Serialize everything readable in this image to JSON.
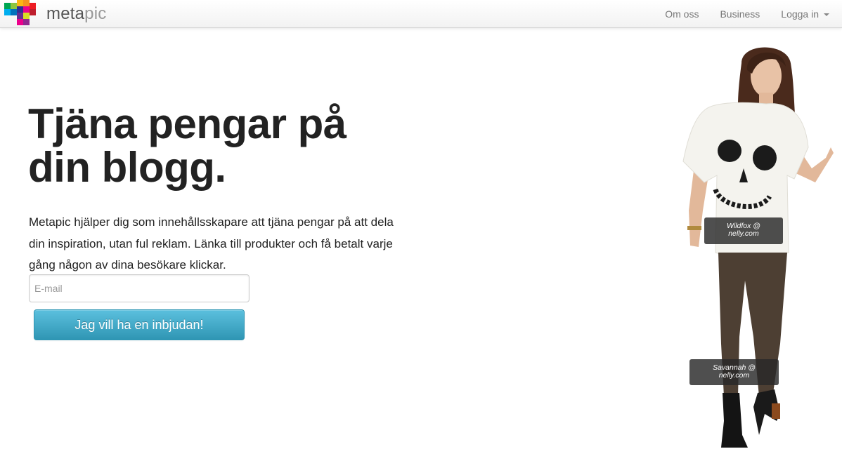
{
  "navbar": {
    "brand": {
      "name_bold": "meta",
      "name_light": "pic"
    },
    "links": [
      {
        "label": "Om oss"
      },
      {
        "label": "Business"
      },
      {
        "label": "Logga in",
        "has_dropdown": true
      }
    ]
  },
  "hero": {
    "headline_line1": "Tjäna pengar på",
    "headline_line2": "din blogg.",
    "lead": "Metapic hjälper dig som innehållsskapare att tjäna pengar på att dela din inspiration, utan ful reklam. Länka till produkter och få betalt varje gång någon av dina besökare klickar.",
    "email_placeholder": "E-mail",
    "email_value": "",
    "cta_label": "Jag vill ha en inbjudan!"
  },
  "product_tags": [
    {
      "line1": "Wildfox @",
      "line2": "nelly.com"
    },
    {
      "line1": "Savannah @",
      "line2": "nelly.com"
    }
  ],
  "colors": {
    "cta_top": "#5bc0de",
    "cta_bottom": "#2f96b4",
    "nav_text": "#777777",
    "headline": "#222222"
  }
}
